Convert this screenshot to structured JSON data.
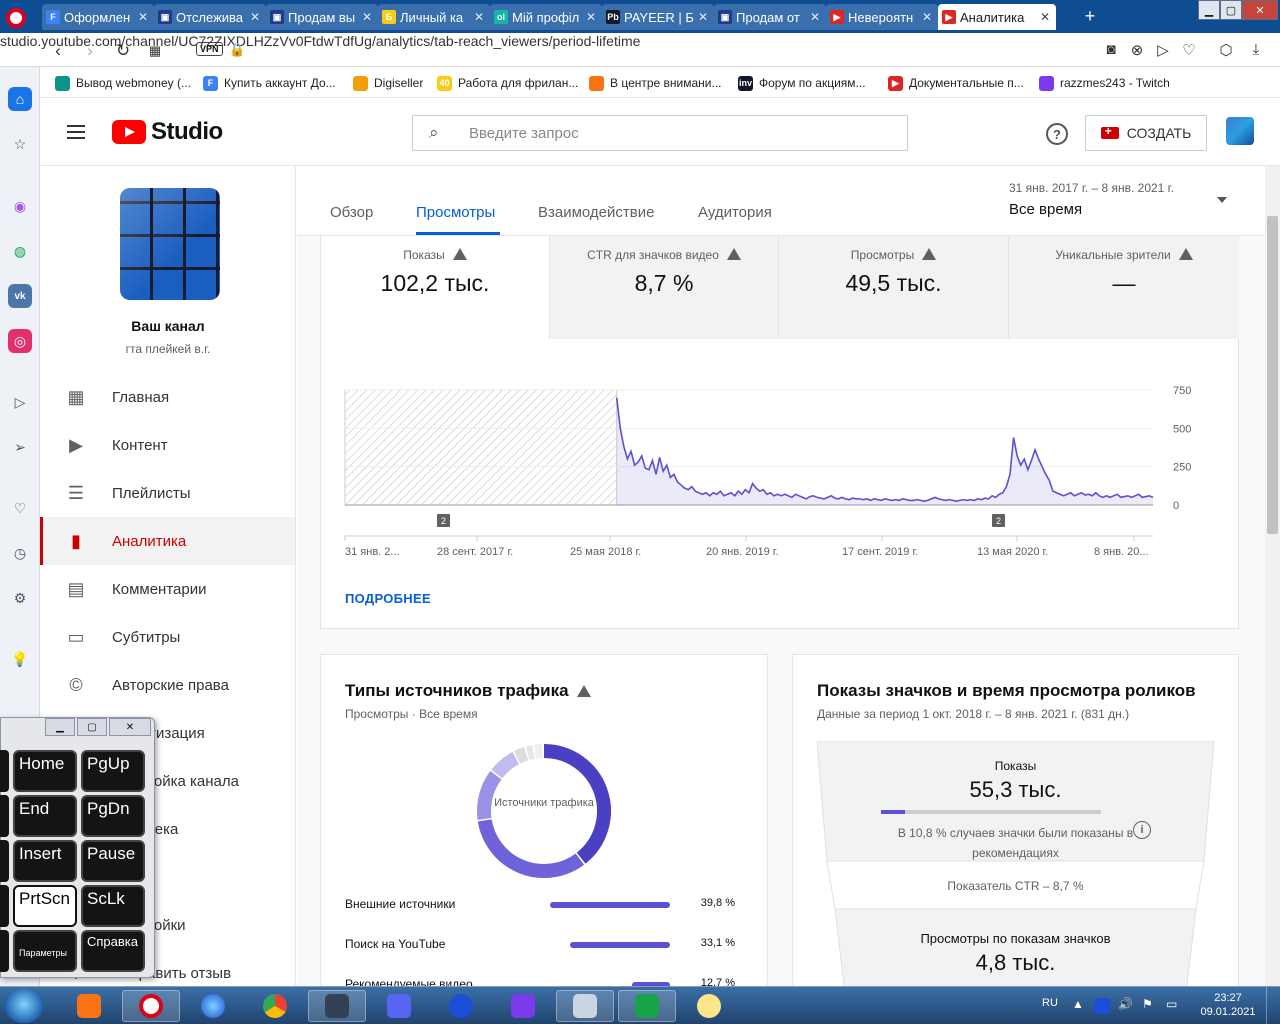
{
  "browser": {
    "tabs": [
      {
        "title": "Оформлен",
        "icon": "F",
        "color": "#3b82f6"
      },
      {
        "title": "Отслежива",
        "icon": "▣",
        "color": "#1e3a8a"
      },
      {
        "title": "Продам вы",
        "icon": "▣",
        "color": "#1e3a8a"
      },
      {
        "title": "Личный ка",
        "icon": "Б",
        "color": "#facc15"
      },
      {
        "title": "Мій профіл",
        "icon": "ol",
        "color": "#14b8a6"
      },
      {
        "title": "PAYEER | Б",
        "icon": "Pb",
        "color": "#111827"
      },
      {
        "title": "Продам от",
        "icon": "▣",
        "color": "#1e3a8a"
      },
      {
        "title": "Невероятн",
        "icon": "▶",
        "color": "#dc2626"
      },
      {
        "title": "Аналитика",
        "icon": "▶",
        "color": "#dc2626"
      }
    ],
    "new_tab": "+",
    "url": "studio.youtube.com/channel/UC72ZIXDLHZzVv0FtdwTdfUg/analytics/tab-reach_viewers/period-lifetime",
    "vpn": "VPN",
    "bookmarks": [
      {
        "label": "Вывод webmoney (...",
        "color": "#0d9488",
        "icon": ""
      },
      {
        "label": "Купить аккаунт До...",
        "color": "#3b82f6",
        "icon": "F"
      },
      {
        "label": "Digiseller",
        "color": "#f59e0b",
        "icon": ""
      },
      {
        "label": "Работа для фрилан...",
        "color": "#facc15",
        "icon": "40"
      },
      {
        "label": "В центре внимани...",
        "color": "#f97316",
        "icon": ""
      },
      {
        "label": "Форум по акциям...",
        "color": "#111827",
        "icon": "inv"
      },
      {
        "label": "Документальные п...",
        "color": "#dc2626",
        "icon": "▶"
      },
      {
        "label": "razzmes243 - Twitch",
        "color": "#7c3aed",
        "icon": ""
      }
    ]
  },
  "studio": {
    "logo_text": "Studio",
    "search_placeholder": "Введите запрос",
    "create_label": "СОЗДАТЬ",
    "channel": {
      "name": "Ваш канал",
      "subtitle": "гта плейкей в.г."
    },
    "nav": [
      {
        "label": "Главная",
        "icon": "dashboard-icon"
      },
      {
        "label": "Контент",
        "icon": "video-library-icon"
      },
      {
        "label": "Плейлисты",
        "icon": "playlist-icon"
      },
      {
        "label": "Аналитика",
        "icon": "analytics-icon",
        "active": true
      },
      {
        "label": "Комментарии",
        "icon": "comments-icon"
      },
      {
        "label": "Субтитры",
        "icon": "subtitles-icon"
      },
      {
        "label": "Авторские права",
        "icon": "copyright-icon"
      },
      {
        "label": "Монетизация",
        "icon": "monetization-icon"
      },
      {
        "label": "Настройка канала",
        "icon": "customization-icon"
      },
      {
        "label": "Фонотека",
        "icon": "audio-library-icon"
      },
      {
        "label": "",
        "icon": ""
      },
      {
        "label": "Настройки",
        "icon": "settings-icon"
      },
      {
        "label": "Отправить отзыв",
        "icon": "feedback-icon"
      }
    ],
    "tabs": [
      "Обзор",
      "Просмотры",
      "Взаимодействие",
      "Аудитория"
    ],
    "active_tab": "Просмотры",
    "date_range": "31 янв. 2017 г. – 8 янв. 2021 г.",
    "period": "Все время",
    "metrics": [
      {
        "label": "Показы",
        "value": "102,2 тыс."
      },
      {
        "label": "CTR для значков видео",
        "value": "8,7 %"
      },
      {
        "label": "Просмотры",
        "value": "49,5 тыс."
      },
      {
        "label": "Уникальные зрители",
        "value": "—"
      }
    ],
    "more_label": "ПОДРОБНЕЕ",
    "traffic": {
      "title": "Типы источников трафика",
      "subtitle": "Просмотры · Все время",
      "donut_label": "Источники трафика",
      "sources": [
        {
          "name": "Внешние источники",
          "pct": "39,8 %",
          "value": 39.8
        },
        {
          "name": "Поиск на YouTube",
          "pct": "33,1 %",
          "value": 33.1
        },
        {
          "name": "Рекомендуемые видео",
          "pct": "12,7 %",
          "value": 12.7
        }
      ]
    },
    "funnel": {
      "title": "Показы значков и время просмотра роликов",
      "subtitle": "Данные за период 1 окт. 2018 г. – 8 янв. 2021 г. (831 дн.)",
      "impressions_label": "Показы",
      "impressions_value": "55,3 тыс.",
      "recommend_share": 10.8,
      "recommend_note": "В 10,8 % случаев значки были показаны в рекомендациях",
      "ctr_text": "Показатель CTR – 8,7 %",
      "views_label": "Просмотры по показам значков",
      "views_value": "4,8 тыс."
    }
  },
  "chart_data": {
    "type": "area",
    "x_ticks": [
      "31 янв. 2...",
      "28 сент. 2017 г.",
      "25 мая 2018 г.",
      "20 янв. 2019 г.",
      "17 сент. 2019 г.",
      "13 мая 2020 г.",
      "8 янв. 20..."
    ],
    "y_ticks": [
      "750",
      "500",
      "250",
      "0"
    ],
    "ylim": [
      0,
      750
    ],
    "markers": [
      "2",
      "2"
    ],
    "series": [
      {
        "values": [
          0,
          0,
          0,
          0,
          0,
          0,
          0,
          0,
          0,
          0,
          0,
          0,
          0,
          0,
          0,
          0,
          0,
          0,
          0,
          0,
          0,
          0,
          0,
          0,
          0,
          0,
          0,
          0,
          0,
          0,
          0,
          0,
          0,
          0,
          0,
          0,
          0,
          0,
          0,
          0,
          0,
          0,
          0,
          0,
          0,
          0,
          0,
          0,
          0,
          0,
          0,
          0,
          0,
          0,
          0,
          0,
          0,
          0,
          0,
          0,
          0,
          0,
          0,
          0,
          0,
          0,
          0,
          0,
          0,
          0,
          0,
          0,
          0,
          0,
          0,
          0,
          700,
          500,
          380,
          300,
          350,
          260,
          280,
          320,
          240,
          230,
          290,
          200,
          310,
          220,
          260,
          180,
          200,
          150,
          130,
          110,
          100,
          120,
          90,
          80,
          70,
          80,
          60,
          80,
          70,
          90,
          60,
          70,
          80,
          60,
          90,
          70,
          100,
          80,
          140,
          110,
          90,
          100,
          70,
          80,
          60,
          70,
          60,
          70,
          60,
          50,
          70,
          60,
          50,
          40,
          55,
          60,
          50,
          45,
          40,
          50,
          60,
          45,
          40,
          50,
          40,
          35,
          45,
          40,
          40,
          35,
          40,
          30,
          40,
          35,
          30,
          40,
          35,
          30,
          35,
          30,
          40,
          35,
          30,
          30,
          35,
          30,
          25,
          30,
          40,
          50,
          40,
          35,
          30,
          35,
          30,
          25,
          30,
          35,
          30,
          35,
          30,
          40,
          35,
          45,
          40,
          60,
          50,
          70,
          80,
          120,
          200,
          440,
          320,
          260,
          300,
          230,
          290,
          360,
          300,
          250,
          200,
          160,
          90,
          80,
          70,
          60,
          70,
          80,
          60,
          70,
          80,
          65,
          70,
          60,
          80,
          60,
          50,
          60,
          50,
          60,
          70,
          50,
          55,
          60,
          50,
          60,
          70,
          50,
          55,
          60,
          50
        ]
      }
    ]
  }
}
